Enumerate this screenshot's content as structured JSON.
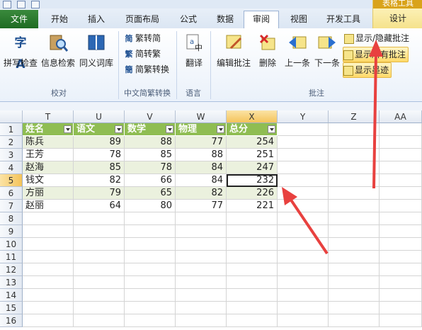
{
  "tabs": {
    "file": "文件",
    "items": [
      "开始",
      "插入",
      "页面布局",
      "公式",
      "数据",
      "审阅",
      "视图",
      "开发工具"
    ],
    "active": "审阅",
    "context_group": "表格工具",
    "context_tab": "设计"
  },
  "ribbon": {
    "groups": {
      "proofing": "校对",
      "chinese": "中文简繁转换",
      "language": "语言",
      "comments": "批注"
    },
    "buttons": {
      "spell": "拼写检查",
      "research": "信息检索",
      "thesaurus": "同义词库",
      "to_simplified": "繁转简",
      "to_traditional": "简转繁",
      "convert": "简繁转换",
      "translate": "翻译",
      "edit_comment": "编辑批注",
      "delete": "删除",
      "previous": "上一条",
      "next": "下一条",
      "show_hide": "显示/隐藏批注",
      "show_all": "显示所有批注",
      "show_ink": "显示墨迹"
    }
  },
  "sheet": {
    "columns": [
      "T",
      "U",
      "V",
      "W",
      "X",
      "Y",
      "Z",
      "AA"
    ],
    "selected_column": "X",
    "rows": [
      "1",
      "2",
      "3",
      "4",
      "5",
      "6",
      "7",
      "8",
      "9",
      "10",
      "11",
      "12",
      "13",
      "14",
      "15",
      "16"
    ],
    "selected_row": "5",
    "headers": [
      "姓名",
      "语文",
      "数学",
      "物理",
      "总分"
    ],
    "data": [
      [
        "陈兵",
        "89",
        "88",
        "77",
        "254"
      ],
      [
        "王芳",
        "78",
        "85",
        "88",
        "251"
      ],
      [
        "赵海",
        "85",
        "78",
        "84",
        "247"
      ],
      [
        "钱文",
        "82",
        "66",
        "84",
        "232"
      ],
      [
        "方丽",
        "79",
        "65",
        "82",
        "226"
      ],
      [
        "赵丽",
        "64",
        "80",
        "77",
        "221"
      ]
    ]
  },
  "colors": {
    "header_fill": "#8fbd52",
    "band_fill": "#ebf1de",
    "file_tab": "#2a7a2e",
    "arrow": "#e8413f"
  }
}
